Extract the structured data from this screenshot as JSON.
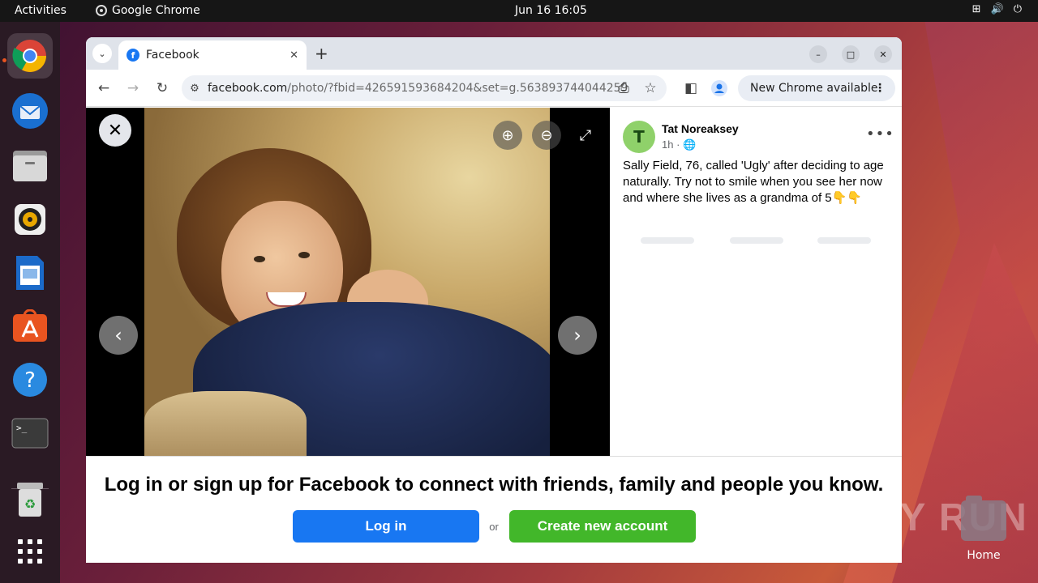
{
  "topbar": {
    "activities": "Activities",
    "app_name": "Google Chrome",
    "clock": "Jun 16  16:05"
  },
  "dock": {
    "items": [
      {
        "name": "chrome",
        "icon": "chrome-icon"
      },
      {
        "name": "thunderbird",
        "icon": "thunderbird-icon"
      },
      {
        "name": "files",
        "icon": "files-icon"
      },
      {
        "name": "rhythmbox",
        "icon": "rhythmbox-icon"
      },
      {
        "name": "writer",
        "icon": "libreoffice-writer-icon"
      },
      {
        "name": "software",
        "icon": "app-center-icon"
      },
      {
        "name": "help",
        "icon": "help-icon"
      },
      {
        "name": "terminal",
        "icon": "terminal-icon"
      },
      {
        "name": "trash",
        "icon": "trash-icon"
      },
      {
        "name": "apps",
        "icon": "show-apps-icon"
      }
    ]
  },
  "browser": {
    "tab_title": "Facebook",
    "url_host": "facebook.com",
    "url_path": "/photo/?fbid=426591593684204&set=g.563893744044259",
    "new_chrome": "New Chrome available"
  },
  "post": {
    "avatar_letter": "T",
    "author": "Tat Noreaksey",
    "time": "1h ·",
    "text": "Sally Field, 76, called 'Ugly' after deciding to age naturally. Try not to smile when you see her now and where she lives as a grandma of 5👇👇"
  },
  "login": {
    "title": "Log in or sign up for Facebook to connect with friends, family and people you know.",
    "login_button": "Log in",
    "or": "or",
    "create_button": "Create new account"
  },
  "desktop": {
    "home_label": "Home",
    "watermark": "ANY RUN"
  },
  "colors": {
    "facebook_blue": "#1877f2",
    "create_green": "#42b72a",
    "ubuntu_orange": "#e95420"
  }
}
